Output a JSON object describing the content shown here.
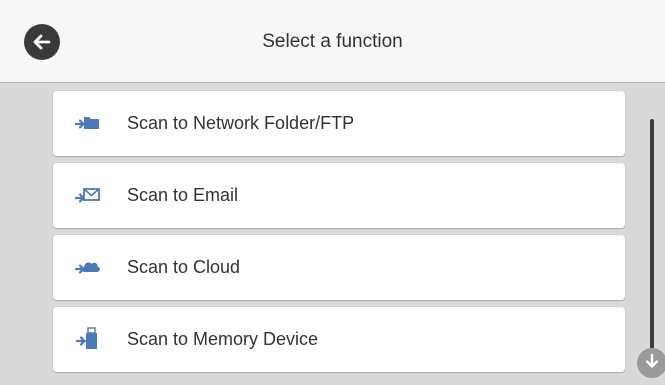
{
  "header": {
    "title": "Select a function",
    "back_icon": "arrow-left-circle-icon"
  },
  "menu": {
    "items": [
      {
        "label": "Scan to Network Folder/FTP",
        "icon": "network-folder-icon"
      },
      {
        "label": "Scan to Email",
        "icon": "email-icon"
      },
      {
        "label": "Scan to Cloud",
        "icon": "cloud-icon"
      },
      {
        "label": "Scan to Memory Device",
        "icon": "memory-device-icon"
      }
    ]
  },
  "scroll": {
    "down_icon": "arrow-down-circle-icon"
  },
  "colors": {
    "icon_blue": "#4a7ab8",
    "header_bg": "#f7f7f7",
    "content_bg": "#d9d9d9",
    "back_button": "#3a3a3a"
  }
}
